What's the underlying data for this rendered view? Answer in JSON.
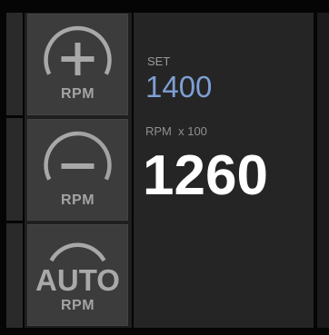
{
  "buttons": {
    "increase": {
      "label": "RPM"
    },
    "decrease": {
      "label": "RPM"
    },
    "auto": {
      "text": "AUTO",
      "label": "RPM"
    }
  },
  "readout": {
    "set_label": "SET",
    "set_value": "1400",
    "rpm_label": "RPM  x 100",
    "rpm_value": "1260"
  },
  "colors": {
    "set_value": "#7d9fd4",
    "rpm_value": "#ffffff",
    "button_bg": "#3c3c3c",
    "panel_bg": "#252525"
  }
}
